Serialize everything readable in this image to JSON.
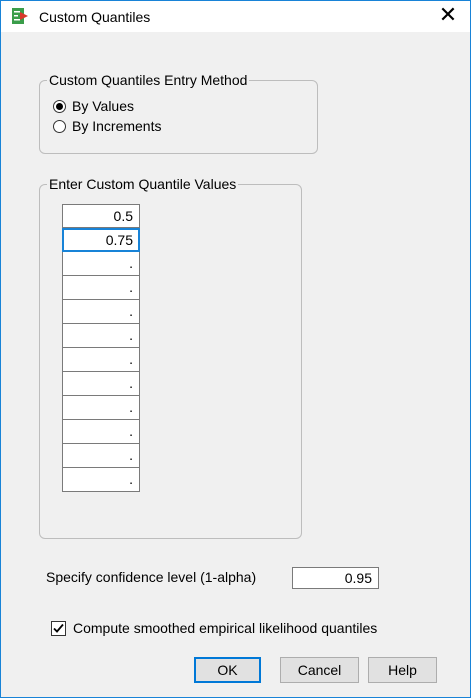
{
  "window": {
    "title": "Custom Quantiles",
    "close_symbol": "✕"
  },
  "entry_method": {
    "group_title": "Custom Quantiles Entry Method",
    "options": [
      {
        "label": "By Values",
        "selected": true
      },
      {
        "label": "By Increments",
        "selected": false
      }
    ]
  },
  "quantile_values": {
    "group_title": "Enter Custom Quantile Values",
    "cells": [
      "0.5",
      "0.75",
      ".",
      ".",
      ".",
      ".",
      ".",
      ".",
      ".",
      ".",
      ".",
      "."
    ]
  },
  "confidence": {
    "label": "Specify confidence level (1-alpha)",
    "value": "0.95"
  },
  "smoothed": {
    "label": "Compute smoothed empirical likelihood quantiles",
    "checked": true
  },
  "buttons": {
    "ok": "OK",
    "cancel": "Cancel",
    "help": "Help"
  },
  "colors": {
    "accent": "#1883d7",
    "background": "#f0f0f0",
    "icon_green": "#3a9d4a",
    "icon_red": "#d8392b"
  }
}
